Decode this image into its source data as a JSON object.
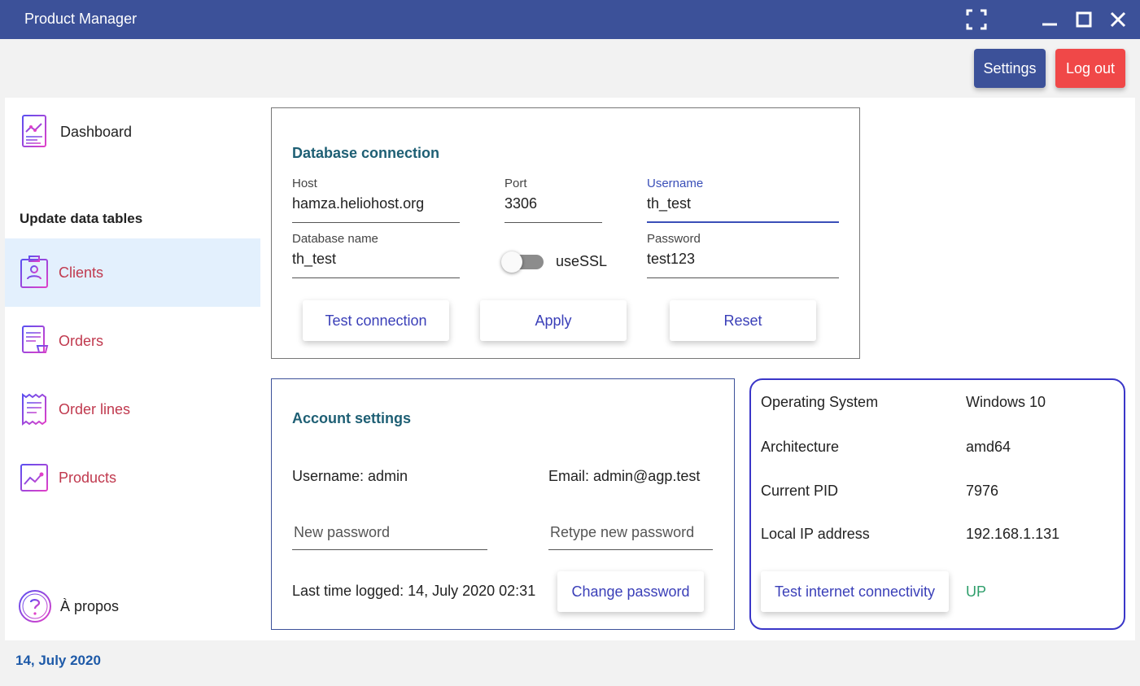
{
  "window": {
    "title": "Product Manager",
    "controls": [
      "fullscreen-icon",
      "minimize-icon",
      "maximize-icon",
      "close-icon"
    ]
  },
  "header": {
    "settings_label": "Settings",
    "logout_label": "Log out",
    "settings_color": "#3c5199",
    "logout_color": "#f04848"
  },
  "sidebar": {
    "dashboard_label": "Dashboard",
    "section_title": "Update data tables",
    "items": [
      {
        "label": "Clients",
        "icon": "clients-icon",
        "active": true
      },
      {
        "label": "Orders",
        "icon": "orders-icon",
        "active": false
      },
      {
        "label": "Order lines",
        "icon": "order-lines-icon",
        "active": false
      },
      {
        "label": "Products",
        "icon": "products-icon",
        "active": false
      }
    ],
    "about_label": "À propos"
  },
  "db": {
    "title": "Database connection",
    "host_label": "Host",
    "host_value": "hamza.heliohost.org",
    "port_label": "Port",
    "port_value": "3306",
    "username_label": "Username",
    "username_value": "th_test",
    "dbname_label": "Database name",
    "dbname_value": "th_test",
    "ssl_label": "useSSL",
    "ssl_enabled": false,
    "password_label": "Password",
    "password_value": "test123",
    "test_btn": "Test connection",
    "apply_btn": "Apply",
    "reset_btn": "Reset"
  },
  "account": {
    "title": "Account settings",
    "username_text": "Username: admin",
    "email_text": "Email: admin@agp.test",
    "new_password_placeholder": "New password",
    "retype_password_placeholder": "Retype new password",
    "last_logged": "Last time logged: 14, July 2020 02:31",
    "change_btn": "Change password"
  },
  "system": {
    "os_label": "Operating System",
    "os_value": "Windows 10",
    "arch_label": "Architecture",
    "arch_value": "amd64",
    "pid_label": "Current PID",
    "pid_value": "7976",
    "ip_label": "Local IP address",
    "ip_value": "192.168.1.131",
    "test_btn": "Test internet connectivity",
    "status": "UP",
    "status_color": "#2e9e6b"
  },
  "footer": {
    "date": "14, July 2020"
  }
}
